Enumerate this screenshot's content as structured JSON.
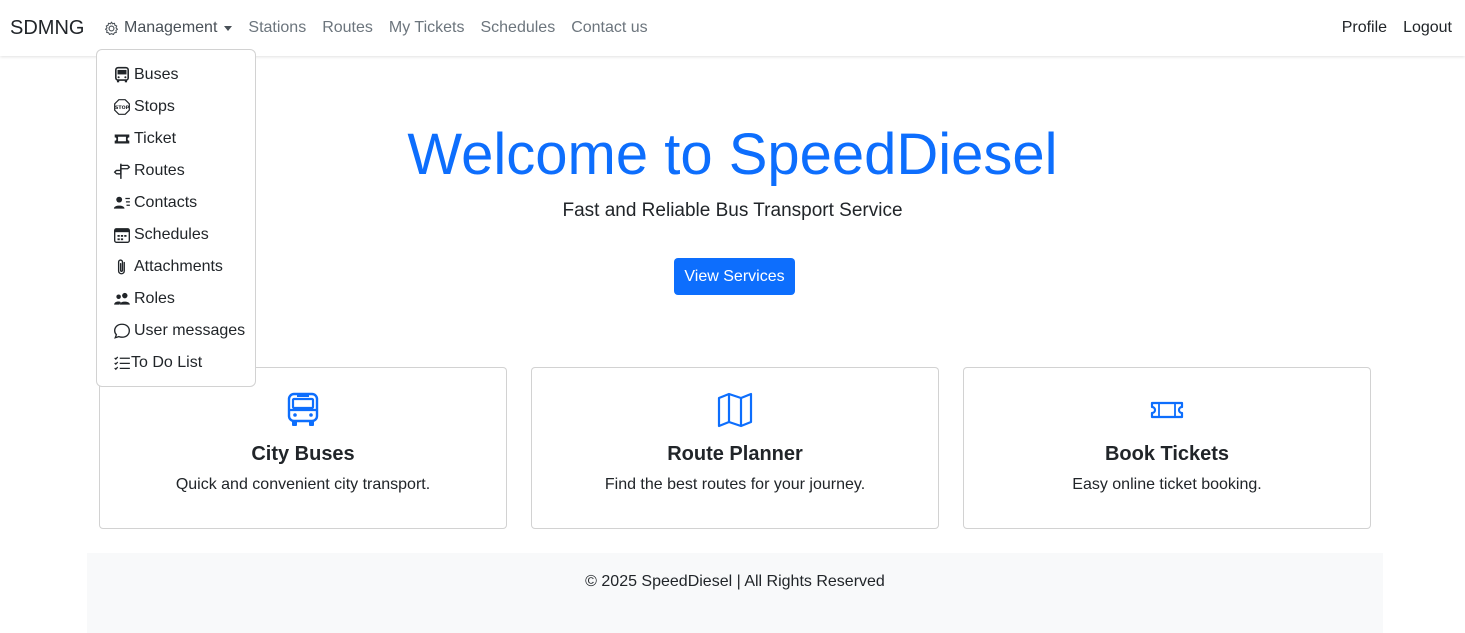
{
  "navbar": {
    "brand": "SDMNG",
    "items": [
      {
        "label": "Management"
      },
      {
        "label": "Stations"
      },
      {
        "label": "Routes"
      },
      {
        "label": "My Tickets"
      },
      {
        "label": "Schedules"
      },
      {
        "label": "Contact us"
      }
    ],
    "right": [
      {
        "label": "Profile"
      },
      {
        "label": "Logout"
      }
    ]
  },
  "dropdown": {
    "items": [
      {
        "label": "Buses",
        "icon": "bus-front-icon"
      },
      {
        "label": "Stops",
        "icon": "stop-sign-icon"
      },
      {
        "label": "Ticket",
        "icon": "ticket-icon"
      },
      {
        "label": "Routes",
        "icon": "signpost-icon"
      },
      {
        "label": "Contacts",
        "icon": "person-lines-icon"
      },
      {
        "label": "Schedules",
        "icon": "calendar-week-icon"
      },
      {
        "label": "Attachments",
        "icon": "paperclip-icon"
      },
      {
        "label": "Roles",
        "icon": "people-icon"
      },
      {
        "label": "User messages",
        "icon": "chat-icon"
      },
      {
        "label": "To Do List",
        "icon": "list-check-icon"
      }
    ]
  },
  "hero": {
    "title": "Welcome to SpeedDiesel",
    "subtitle": "Fast and Reliable Bus Transport Service",
    "button": "View Services"
  },
  "cards": [
    {
      "title": "City Buses",
      "desc": "Quick and convenient city transport.",
      "icon": "bus-icon"
    },
    {
      "title": "Route Planner",
      "desc": "Find the best routes for your journey.",
      "icon": "map-icon"
    },
    {
      "title": "Book Tickets",
      "desc": "Easy online ticket booking.",
      "icon": "ticket-icon"
    }
  ],
  "footer": {
    "text": "© 2025 SpeedDiesel | All Rights Reserved"
  },
  "colors": {
    "primary": "#0d6efd",
    "muted": "#6c757d",
    "footer_bg": "#f8f9fa"
  }
}
